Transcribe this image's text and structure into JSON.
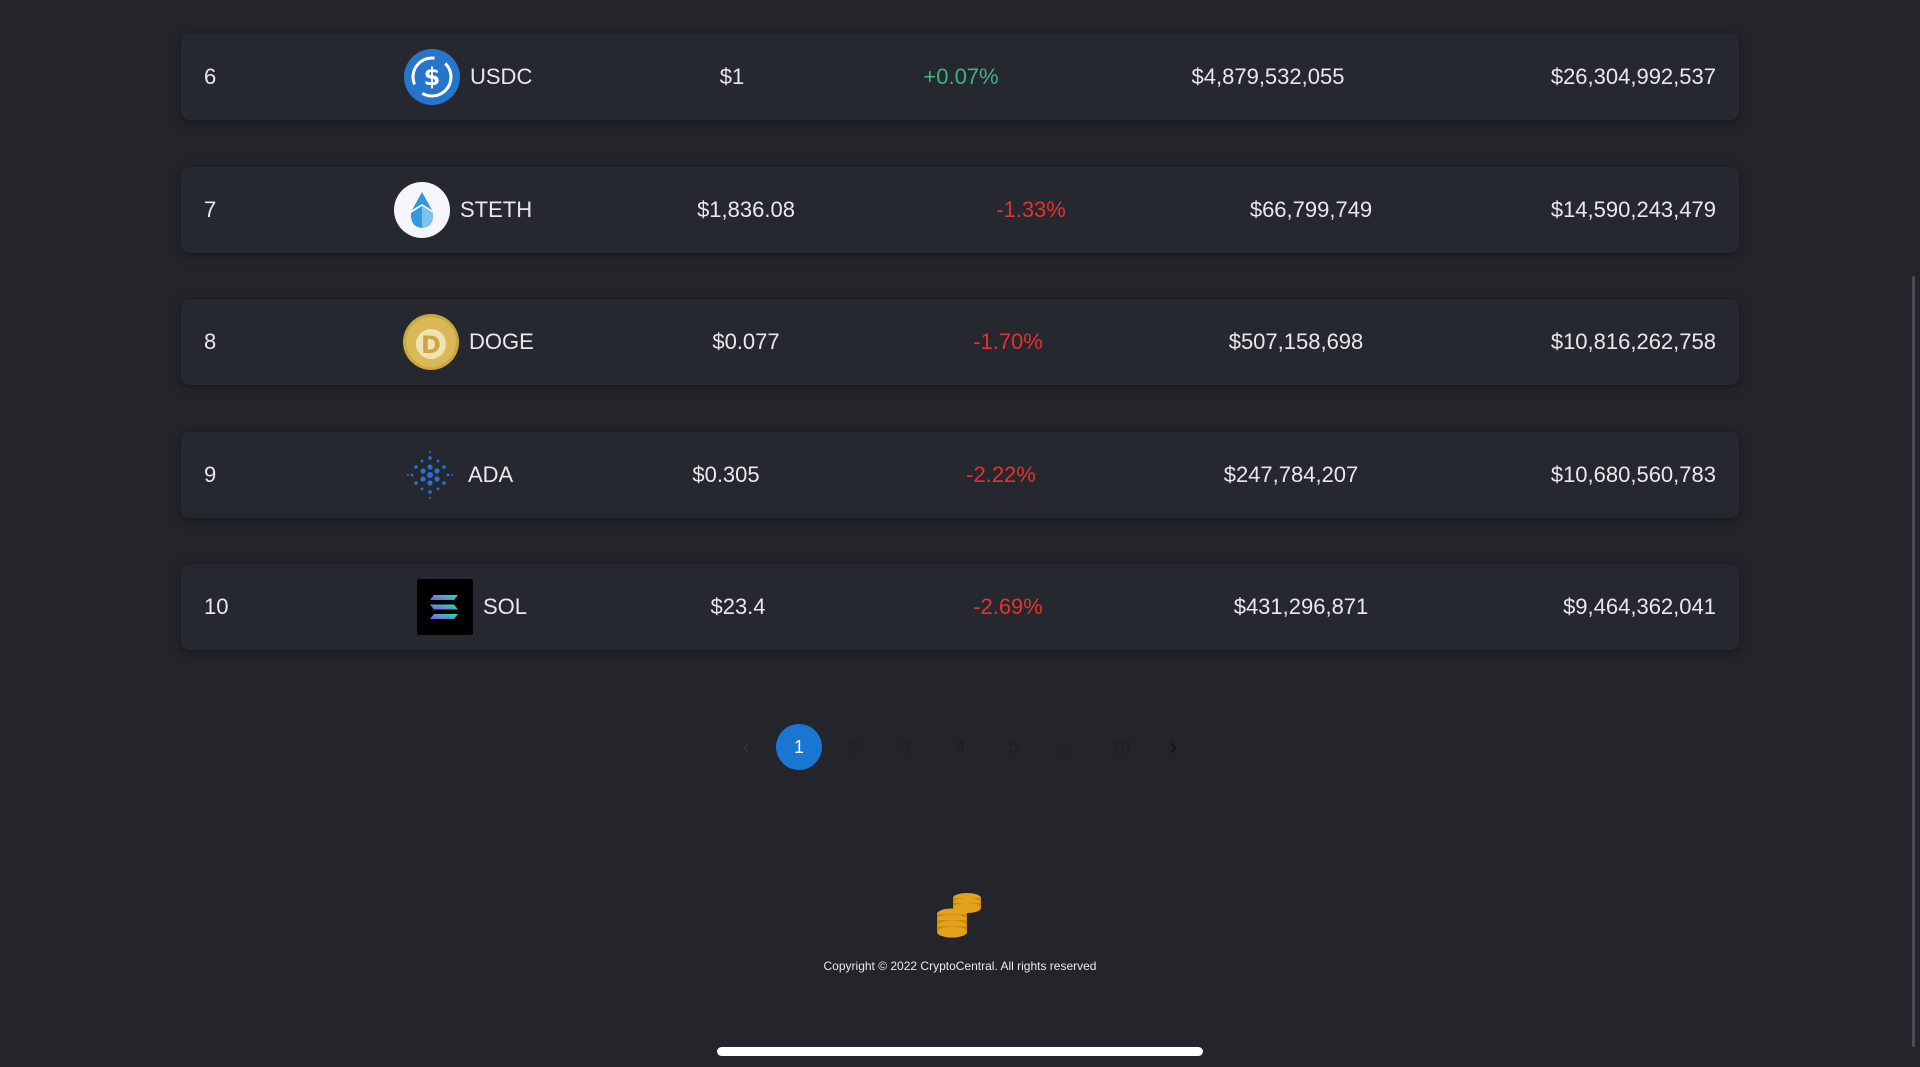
{
  "rows": [
    {
      "rank": "6",
      "symbol": "USDC",
      "price": "$1",
      "change": "+0.07%",
      "direction": "up",
      "volume": "$4,879,532,055",
      "market_cap": "$26,304,992,537",
      "icon": "usdc-icon"
    },
    {
      "rank": "7",
      "symbol": "STETH",
      "price": "$1,836.08",
      "change": "-1.33%",
      "direction": "down",
      "volume": "$66,799,749",
      "market_cap": "$14,590,243,479",
      "icon": "steth-icon"
    },
    {
      "rank": "8",
      "symbol": "DOGE",
      "price": "$0.077",
      "change": "-1.70%",
      "direction": "down",
      "volume": "$507,158,698",
      "market_cap": "$10,816,262,758",
      "icon": "doge-icon"
    },
    {
      "rank": "9",
      "symbol": "ADA",
      "price": "$0.305",
      "change": "-2.22%",
      "direction": "down",
      "volume": "$247,784,207",
      "market_cap": "$10,680,560,783",
      "icon": "ada-icon"
    },
    {
      "rank": "10",
      "symbol": "SOL",
      "price": "$23.4",
      "change": "-2.69%",
      "direction": "down",
      "volume": "$431,296,871",
      "market_cap": "$9,464,362,041",
      "icon": "sol-icon"
    }
  ],
  "pagination": {
    "prev": "‹",
    "pages": [
      "1",
      "2",
      "3",
      "4",
      "5"
    ],
    "ellipsis": "…",
    "last": "10",
    "next": "›",
    "current": "1"
  },
  "footer": {
    "logo_icon": "coins-icon",
    "copyright": "Copyright © 2022 CryptoCentral. All rights reserved"
  },
  "colors": {
    "background": "#23252b",
    "row": "#26282f",
    "up": "#3fb27f",
    "down": "#e5312f",
    "active_page": "#1976d2"
  }
}
